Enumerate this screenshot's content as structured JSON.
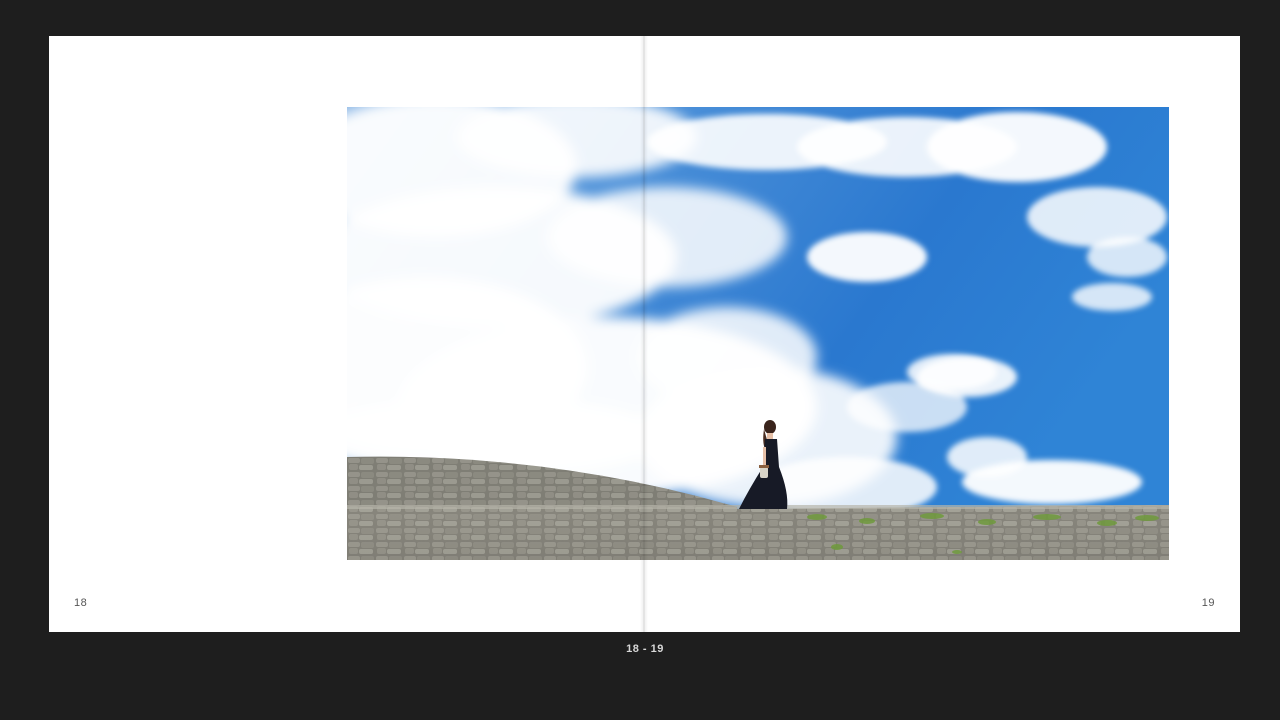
{
  "pages": {
    "left_number": "18",
    "right_number": "19"
  },
  "spread_label": "18 - 19",
  "colors": {
    "viewer_background": "#1e1e1e",
    "page": "#ffffff",
    "sky": "#2f7fd1",
    "wall": "#8a887f"
  },
  "photo": {
    "subject": "photo-woman-walking-on-stone-wall"
  }
}
